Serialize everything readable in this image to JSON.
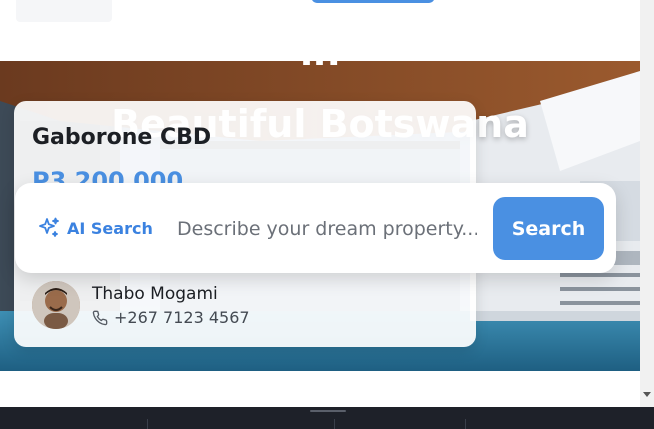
{
  "hero": {
    "headline_top": "in",
    "headline": "Beautiful Botswana"
  },
  "property": {
    "location": "Gaborone CBD",
    "price": "P3 200 000",
    "agent": {
      "name": "Thabo Mogami",
      "phone": "+267 7123 4567"
    }
  },
  "search": {
    "ai_label": "AI Search",
    "placeholder": "Describe your dream property...",
    "button_label": "Search"
  },
  "colors": {
    "accent": "#4a90e2",
    "footer": "#1e2129"
  },
  "icons": {
    "ai": "sparkle-icon",
    "phone": "phone-icon",
    "scroll": "scroll-down-arrow-icon"
  }
}
